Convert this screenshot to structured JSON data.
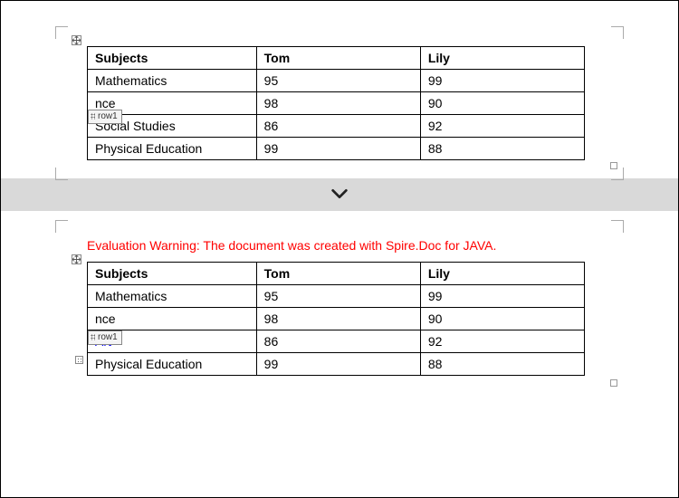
{
  "tagLabel": "row1",
  "warningText": "Evaluation Warning: The document was created with Spire.Doc for JAVA.",
  "headers": {
    "c0": "Subjects",
    "c1": "Tom",
    "c2": "Lily"
  },
  "tableTop": {
    "rows": [
      {
        "c0": "Mathematics",
        "c1": "95",
        "c2": "99"
      },
      {
        "c0": "nce",
        "c1": "98",
        "c2": "90"
      },
      {
        "c0": "Social Studies",
        "c1": "86",
        "c2": "92"
      },
      {
        "c0": "Physical Education",
        "c1": "99",
        "c2": "88"
      }
    ]
  },
  "tableBottom": {
    "rows": [
      {
        "c0": "Mathematics",
        "c1": "95",
        "c2": "99"
      },
      {
        "c0": "nce",
        "c1": "98",
        "c2": "90"
      },
      {
        "c0": "Art",
        "c1": "86",
        "c2": "92",
        "blue": true
      },
      {
        "c0": "Physical Education",
        "c1": "99",
        "c2": "88"
      }
    ]
  }
}
